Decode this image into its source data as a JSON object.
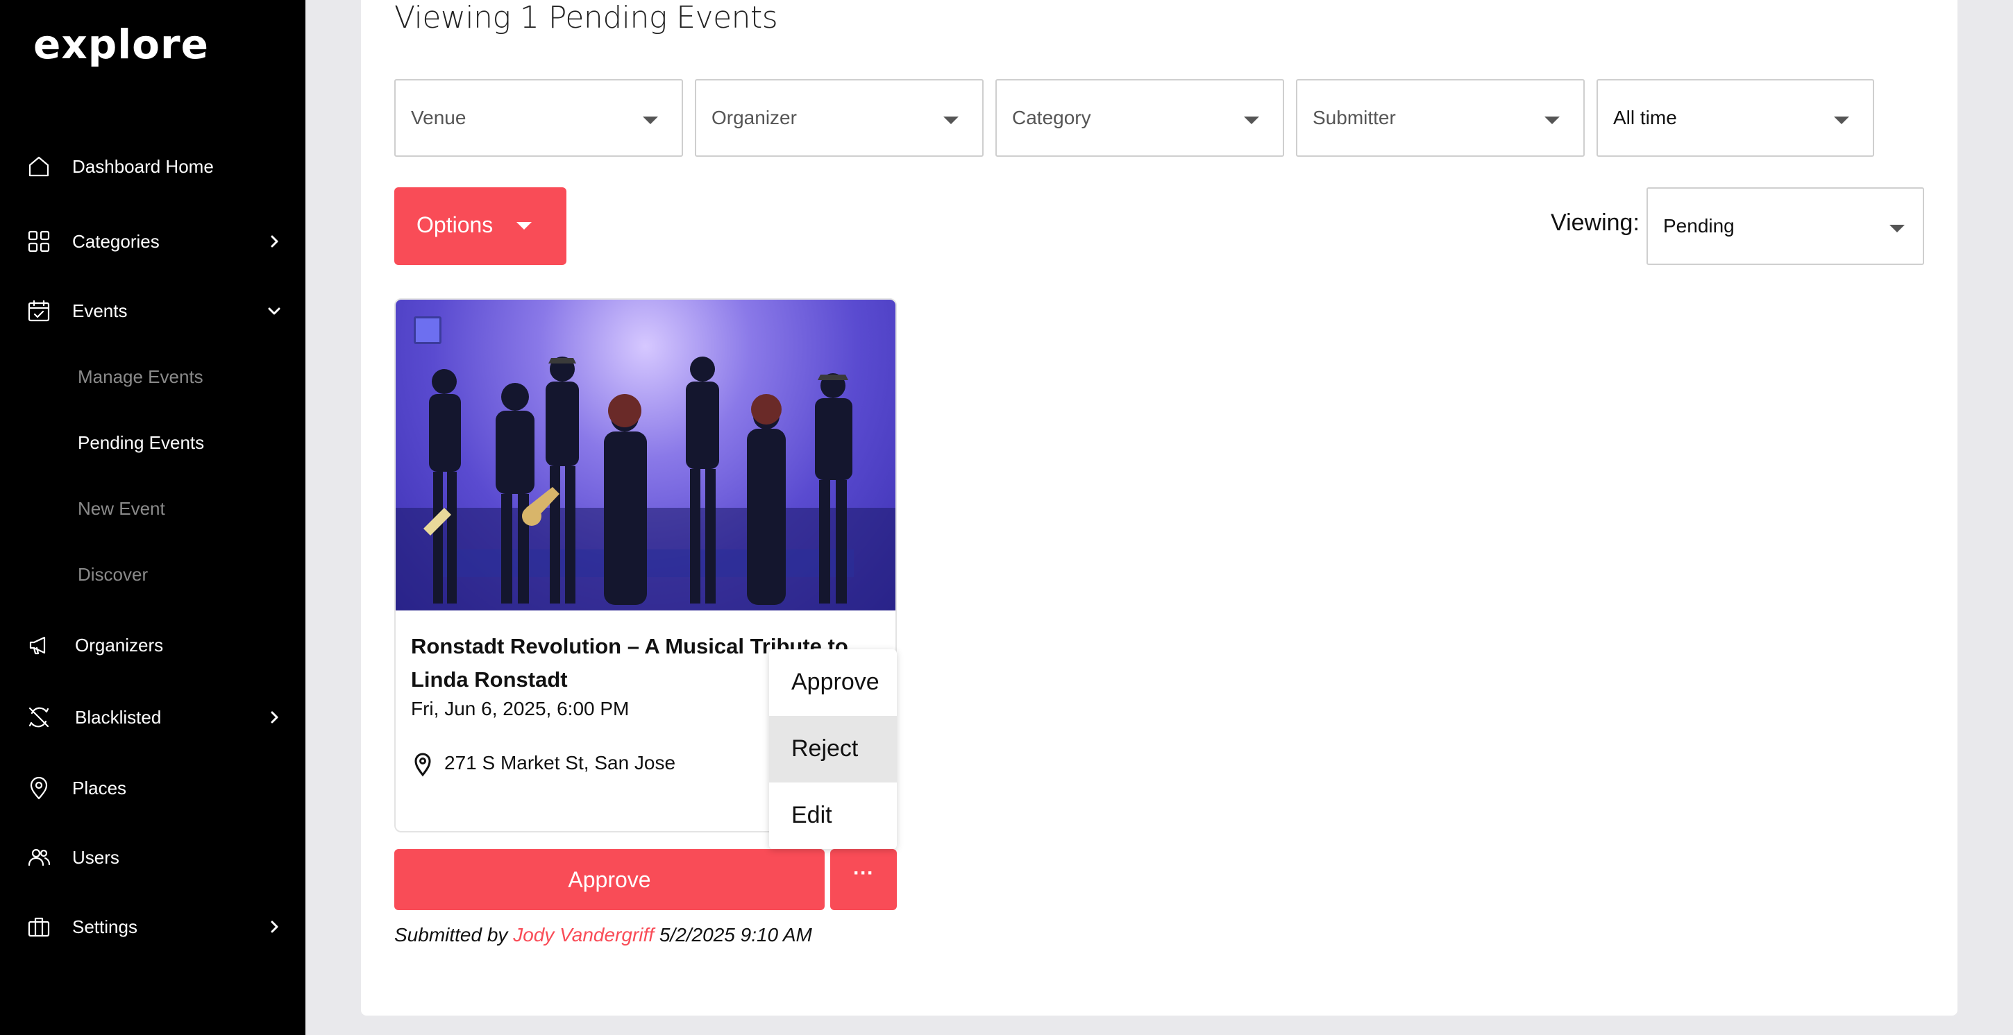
{
  "app": {
    "logo": "explore"
  },
  "sidebar": {
    "items": [
      {
        "label": "Dashboard Home",
        "icon": "home-icon"
      },
      {
        "label": "Categories",
        "icon": "grid-icon"
      },
      {
        "label": "Events",
        "icon": "calendar-check-icon"
      },
      {
        "label": "Organizers",
        "icon": "megaphone-icon"
      },
      {
        "label": "Blacklisted",
        "icon": "blocked-refresh-icon"
      },
      {
        "label": "Places",
        "icon": "location-pin-icon"
      },
      {
        "label": "Users",
        "icon": "users-icon"
      },
      {
        "label": "Settings",
        "icon": "briefcase-icon"
      }
    ],
    "events_subitems": [
      {
        "label": "Manage Events"
      },
      {
        "label": "Pending Events"
      },
      {
        "label": "New Event"
      },
      {
        "label": "Discover"
      }
    ]
  },
  "main": {
    "title": "Viewing 1 Pending Events",
    "filters": [
      {
        "label": "Venue"
      },
      {
        "label": "Organizer"
      },
      {
        "label": "Category"
      },
      {
        "label": "Submitter"
      },
      {
        "label": "All time"
      }
    ],
    "options_label": "Options",
    "viewing_label": "Viewing:",
    "viewing_value": "Pending"
  },
  "event_card": {
    "title": "Ronstadt Revolution – A Musical Tribute to Linda Ronstadt",
    "date": "Fri, Jun 6, 2025, 6:00 PM",
    "address": "271 S Market St, San Jose",
    "approve_label": "Approve",
    "more_label": "···",
    "submitted_prefix": "Submitted by",
    "submitter": "Jody Vandergriff",
    "submitted_time": "5/2/2025 9:10 AM"
  },
  "action_menu": {
    "items": [
      {
        "label": "Approve"
      },
      {
        "label": "Reject"
      },
      {
        "label": "Edit"
      }
    ]
  },
  "colors": {
    "accent": "#f94c57",
    "sidebar_bg": "#000000",
    "page_bg": "#e9e9ec"
  }
}
